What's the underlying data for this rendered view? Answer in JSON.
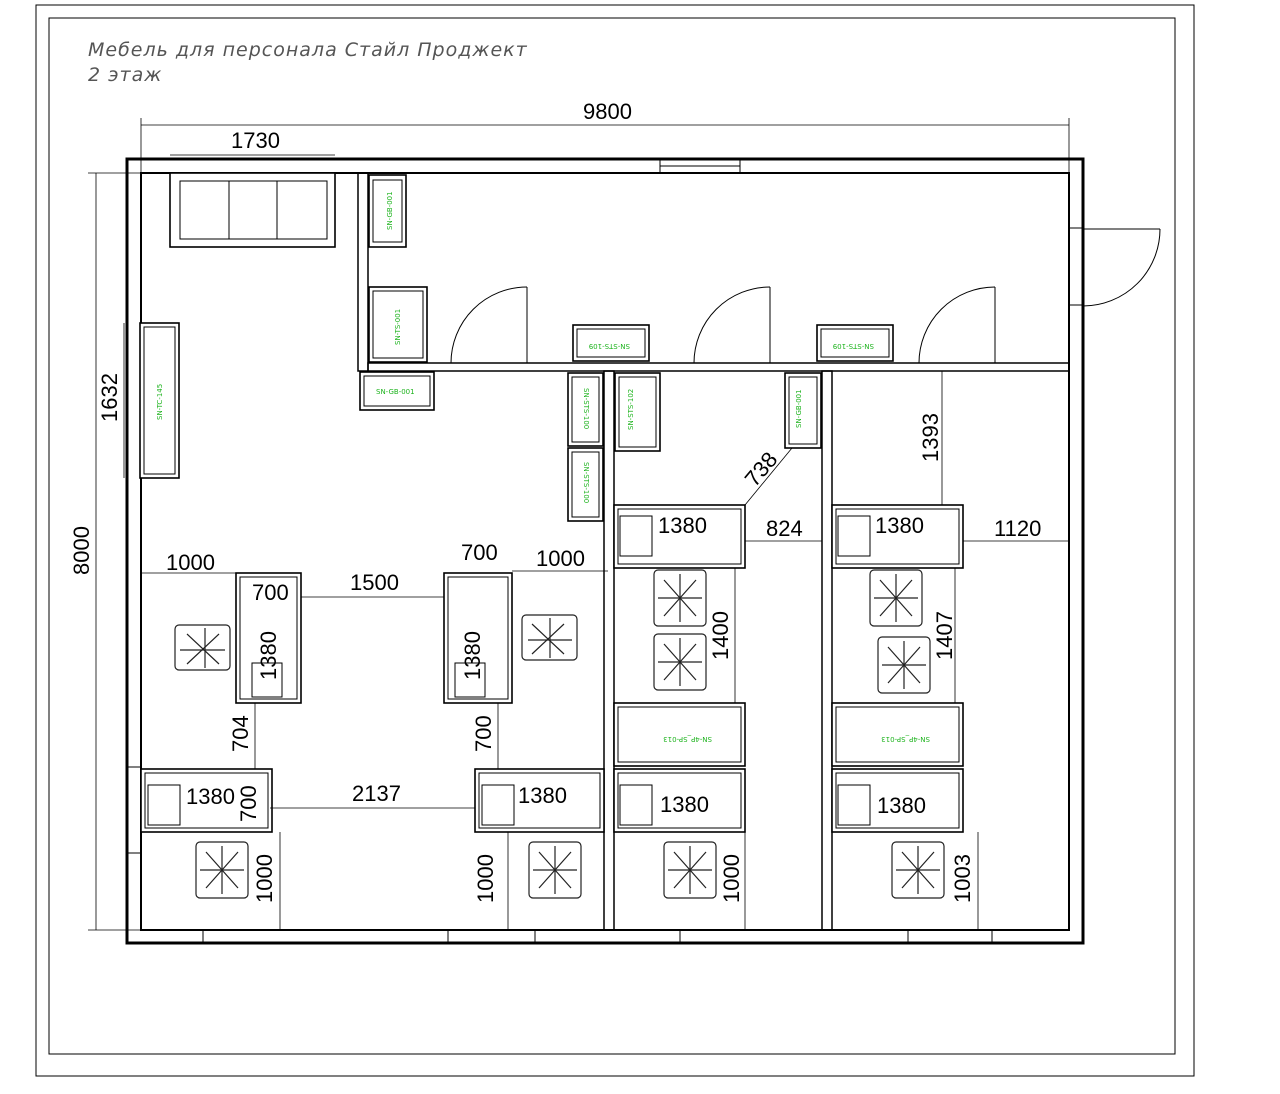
{
  "title": {
    "line1": "Мебель для персонала Стайл Проджект",
    "line2": "2 этаж"
  },
  "dimensions": {
    "overall_width": "9800",
    "overall_height": "8000",
    "sofa_width": "1730",
    "cabinet_height": "1632",
    "d_1000_left": "1000",
    "d_700_a": "700",
    "d_1500": "1500",
    "d_700_b": "700",
    "d_1000_mid": "1000",
    "d_1380_a": "1380",
    "d_1380_b": "1380",
    "d_704": "704",
    "d_700_c": "700",
    "d_1380_c": "1380",
    "d_700_d": "700",
    "d_2137": "2137",
    "d_1380_d": "1380",
    "d_1000_b1": "1000",
    "d_1000_b2": "1000",
    "d_738": "738",
    "d_1380_e": "1380",
    "d_824": "824",
    "d_1400": "1400",
    "d_1380_f": "1380",
    "d_1000_b3": "1000",
    "d_1393": "1393",
    "d_1380_g": "1380",
    "d_1120": "1120",
    "d_1407": "1407",
    "d_1380_h": "1380",
    "d_1003": "1003"
  },
  "labels": {
    "sn_gb_a": "SN-GB-001",
    "sn_ts": "SN-TS-001",
    "sn_gb_b": "SN-GB-001",
    "sn_sts_a": "SN-STS-109",
    "sn_sts_b": "SN-STS-109",
    "sn_sts_100": "SN-STS-100",
    "sn_sts_102": "SN-STS-102",
    "sn_sts_100b": "SN-STS-100",
    "sn_gb_c": "SN-GB-001",
    "sn_tc": "SN-TC-145",
    "sp_a": "SN-4P_SP-013",
    "sp_b": "SN-4P_SP-013"
  },
  "colors": {
    "line": "#000000",
    "label": "#1db31d",
    "title": "#555555"
  }
}
